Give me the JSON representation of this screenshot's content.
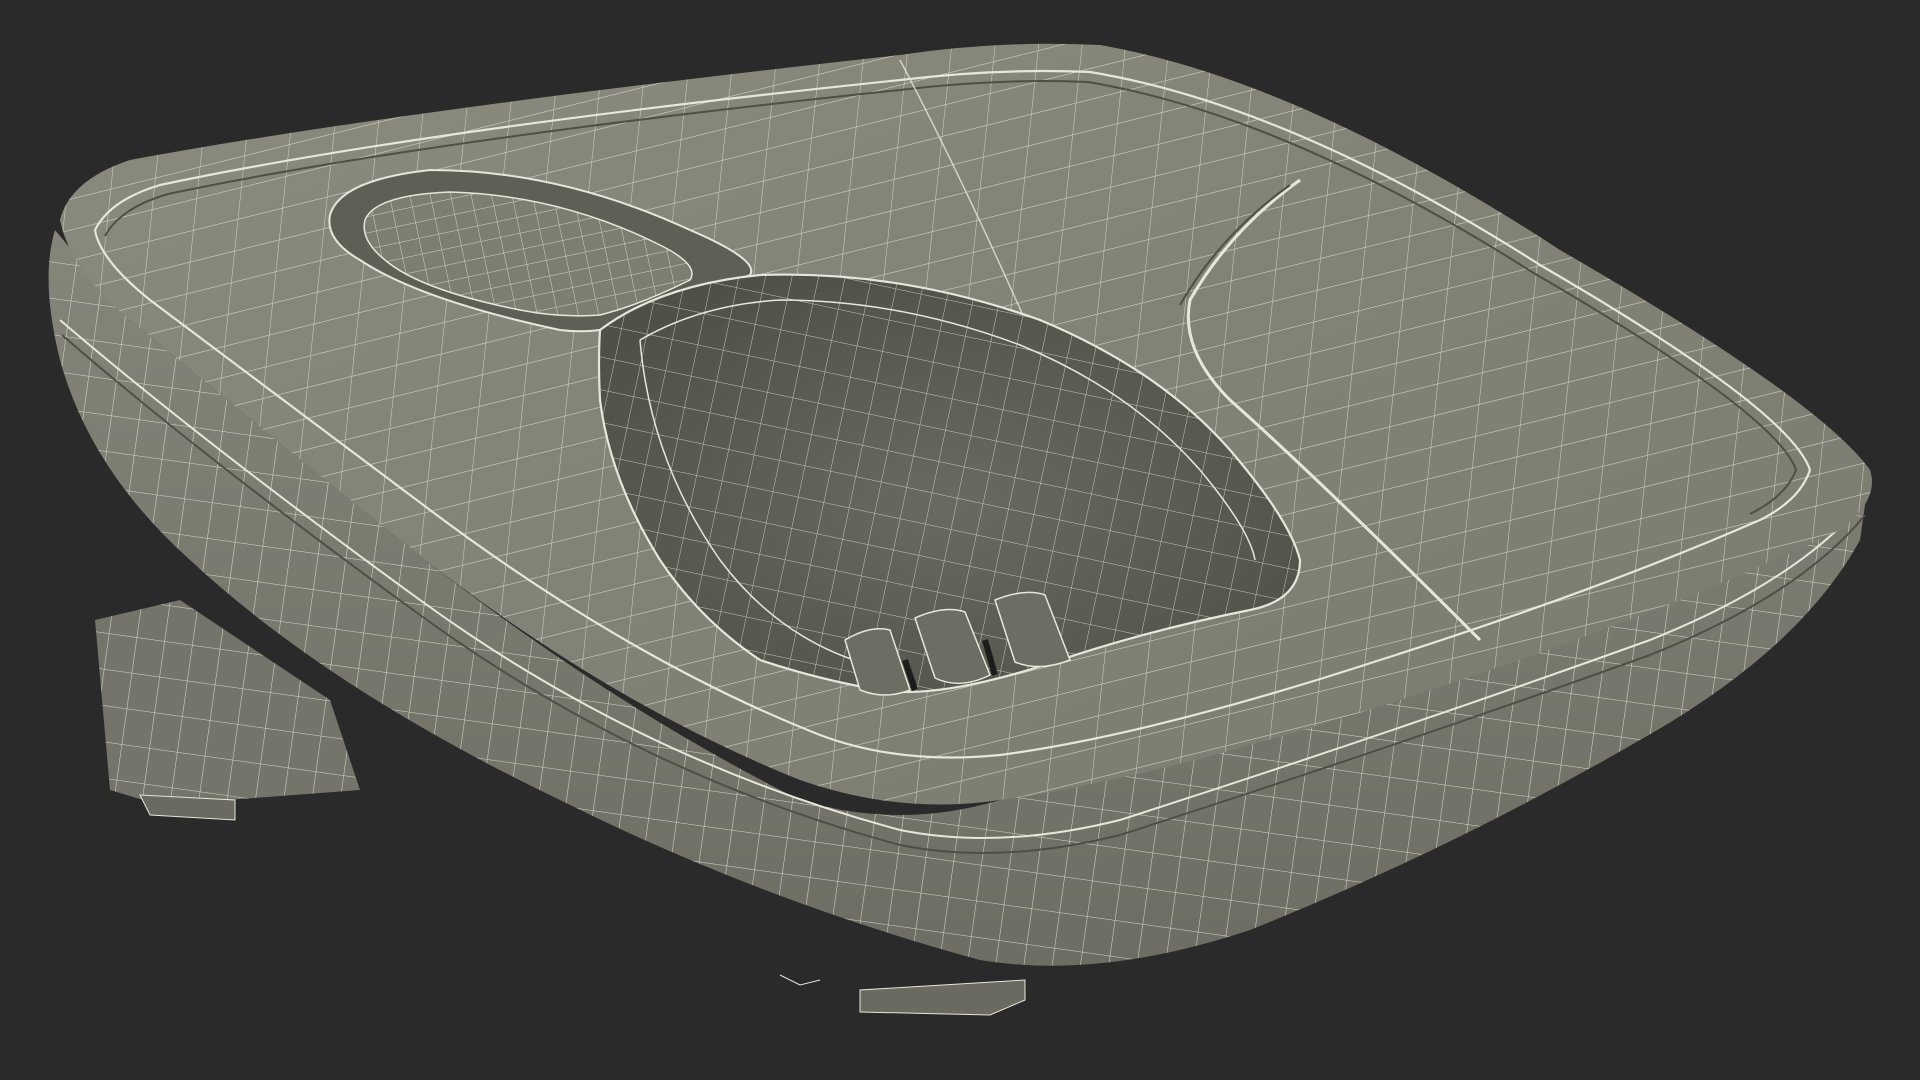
{
  "scene": {
    "background_color": "#2a2a2a",
    "surface_color": "#7f7f73",
    "surface_dark_color": "#5f5f55",
    "cavity_color": "#595a50",
    "wire_color": "#e8e8dc",
    "subject_icon": "wireframe-charging-dock"
  }
}
